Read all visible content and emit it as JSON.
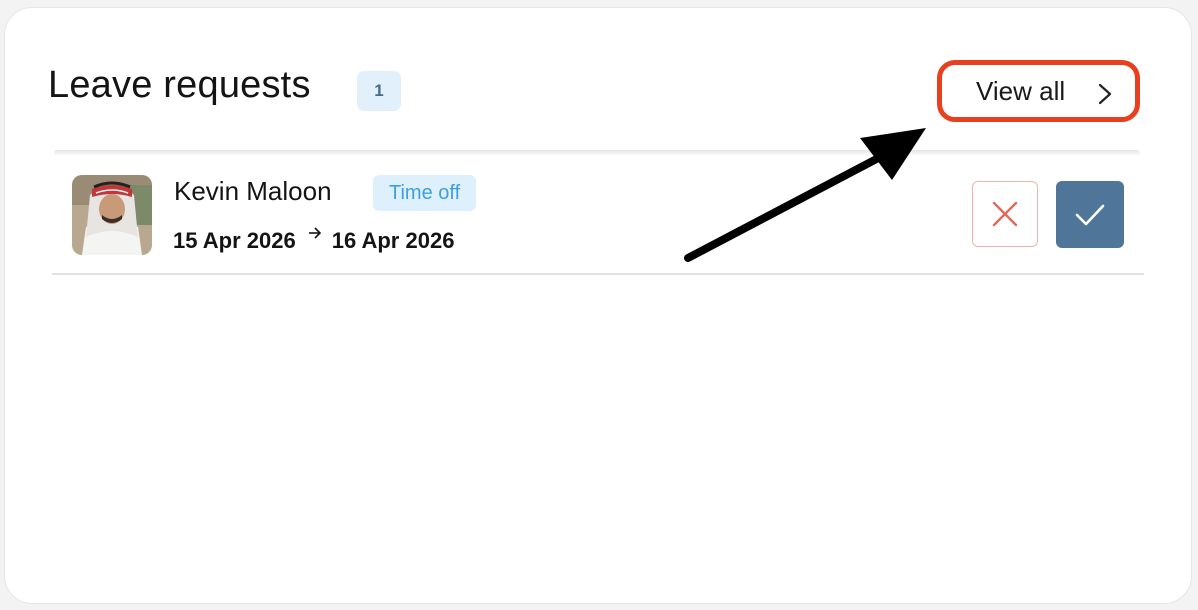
{
  "card": {
    "title": "Leave requests",
    "count": "1",
    "view_all_label": "View all"
  },
  "requests": [
    {
      "name": "Kevin Maloon",
      "type": "Time off",
      "start_date": "15 Apr 2026",
      "end_date": "16 Apr 2026"
    }
  ],
  "colors": {
    "highlight": "#e8401f",
    "approve": "#4f7699",
    "reject": "#e06a5c",
    "badge_bg": "#def0fc",
    "badge_text": "#3d9fe0"
  },
  "icons": {
    "view_all": "chevron-right-icon",
    "reject": "close-icon",
    "approve": "check-icon",
    "date_separator": "arrow-right-icon"
  }
}
